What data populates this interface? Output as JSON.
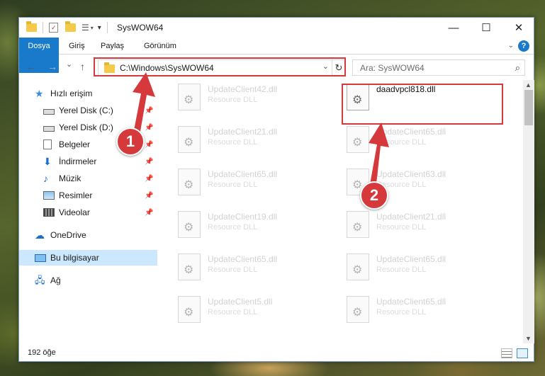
{
  "window": {
    "title": "SysWOW64"
  },
  "ribbon": {
    "tabs": [
      "Dosya",
      "Giriş",
      "Paylaş",
      "Görünüm"
    ],
    "help": "?"
  },
  "nav": {
    "back": "←",
    "forward": "→",
    "recent": "⌄",
    "up": "↑",
    "path": "C:\\Windows\\SysWOW64",
    "search_placeholder": "Ara: SysWOW64"
  },
  "sidebar": {
    "items": [
      {
        "label": "Hızlı erişim",
        "icon": "star-icon"
      },
      {
        "label": "Yerel Disk (C:)",
        "icon": "drive-icon"
      },
      {
        "label": "Yerel Disk (D:)",
        "icon": "drive-icon"
      },
      {
        "label": "Belgeler",
        "icon": "documents-icon"
      },
      {
        "label": "İndirmeler",
        "icon": "download-icon"
      },
      {
        "label": "Müzik",
        "icon": "music-icon"
      },
      {
        "label": "Resimler",
        "icon": "pictures-icon"
      },
      {
        "label": "Videolar",
        "icon": "video-icon"
      },
      {
        "label": "OneDrive",
        "icon": "cloud-icon"
      },
      {
        "label": "Bu bilgisayar",
        "icon": "computer-icon"
      },
      {
        "label": "Ağ",
        "icon": "network-icon"
      }
    ]
  },
  "files": {
    "left": [
      {
        "name": "UpdateClient42.dll",
        "type": "Resource DLL"
      },
      {
        "name": "UpdateClient21.dll",
        "type": "Resource DLL"
      },
      {
        "name": "UpdateClient65.dll",
        "type": "Resource DLL"
      },
      {
        "name": "UpdateClient19.dll",
        "type": "Resource DLL"
      },
      {
        "name": "UpdateClient65.dll",
        "type": "Resource DLL"
      },
      {
        "name": "UpdateClient5.dll",
        "type": "Resource DLL"
      }
    ],
    "right": [
      {
        "name": "daadvpcl818.dll",
        "type": ""
      },
      {
        "name": "UpdateClient65.dll",
        "type": "Resource DLL"
      },
      {
        "name": "UpdateClient63.dll",
        "type": "Resource DLL"
      },
      {
        "name": "UpdateClient21.dll",
        "type": "Resource DLL"
      },
      {
        "name": "UpdateClient65.dll",
        "type": "Resource DLL"
      },
      {
        "name": "UpdateClient65.dll",
        "type": "Resource DLL"
      }
    ]
  },
  "status": {
    "count": "192 öğe"
  },
  "callouts": {
    "one": "1",
    "two": "2"
  },
  "colors": {
    "accent": "#1979ca",
    "callout": "#d6393b"
  }
}
